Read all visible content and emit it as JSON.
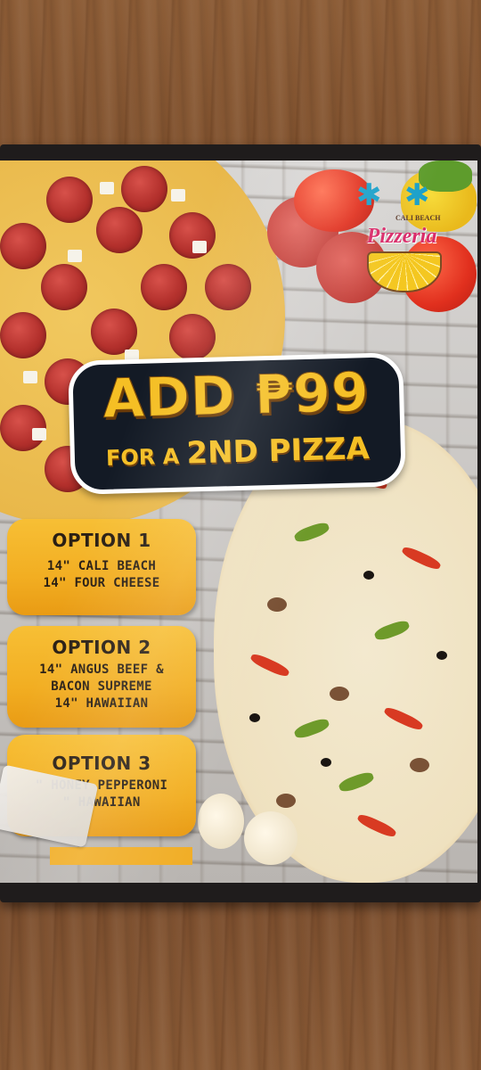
{
  "logo": {
    "caption": "CALI BEACH",
    "name": "Pizzeria"
  },
  "headline": {
    "main": "ADD ₱99",
    "sub_a": "FOR A ",
    "sub_b": "2ND PIZZA"
  },
  "options": [
    {
      "title": "OPTION 1",
      "lines": [
        "14\" CALI BEACH",
        "14\" FOUR CHEESE"
      ]
    },
    {
      "title": "OPTION 2",
      "lines": [
        "14\"  ANGUS BEEF &",
        "BACON SUPREME",
        "14\" HAWAIIAN"
      ]
    },
    {
      "title": "OPTION 3",
      "lines": [
        "\" HONEY PEPPERONI",
        "\" HAWAIIAN"
      ]
    }
  ],
  "colors": {
    "accent_yellow": "#f5bf24",
    "badge_dark": "#131a25",
    "option_card": "#f2ae22",
    "logo_pink": "#d92c6a"
  }
}
